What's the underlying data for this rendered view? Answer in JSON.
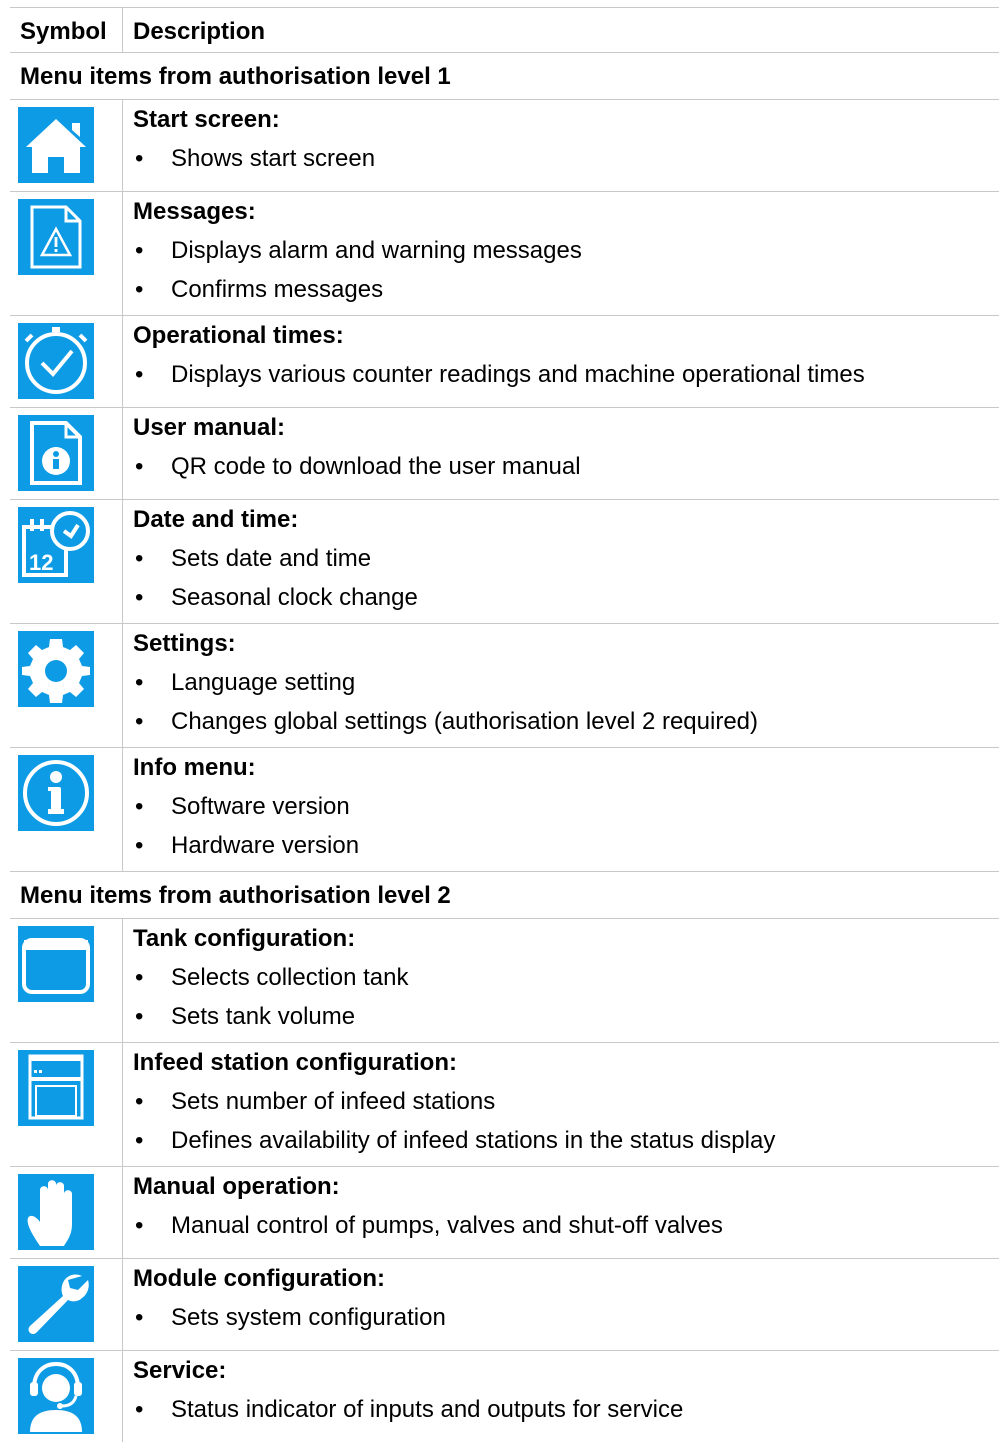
{
  "header": {
    "symbol": "Symbol",
    "description": "Description"
  },
  "sections": [
    {
      "heading": "Menu items from authorisation level 1",
      "items": [
        {
          "icon": "home-icon",
          "title": "Start screen:",
          "bullets": [
            "Shows start screen"
          ]
        },
        {
          "icon": "messages-warning-document-icon",
          "title": "Messages:",
          "bullets": [
            "Displays alarm and warning messages",
            "Confirms messages"
          ]
        },
        {
          "icon": "clock-icon",
          "title": "Operational times:",
          "bullets": [
            "Displays various counter readings and machine operational times"
          ]
        },
        {
          "icon": "info-document-icon",
          "title": "User manual:",
          "bullets": [
            "QR code to download the user manual"
          ]
        },
        {
          "icon": "calendar-clock-icon",
          "title": "Date and time:",
          "bullets": [
            "Sets date and time",
            "Seasonal clock change"
          ]
        },
        {
          "icon": "gear-icon",
          "title": "Settings:",
          "bullets": [
            "Language setting",
            "Changes global settings (authorisation level 2 required)"
          ]
        },
        {
          "icon": "info-circle-icon",
          "title": "Info menu:",
          "bullets": [
            "Software version",
            "Hardware version"
          ]
        }
      ]
    },
    {
      "heading": "Menu items from authorisation level 2",
      "items": [
        {
          "icon": "tank-icon",
          "title": "Tank configuration:",
          "bullets": [
            "Selects collection tank",
            "Sets tank volume"
          ]
        },
        {
          "icon": "infeed-station-icon",
          "title": "Infeed station configuration:",
          "bullets": [
            "Sets number of infeed stations",
            "Defines availability of infeed stations in the status display"
          ]
        },
        {
          "icon": "hand-icon",
          "title": "Manual operation:",
          "bullets": [
            "Manual control of pumps, valves and shut-off valves"
          ]
        },
        {
          "icon": "wrench-icon",
          "title": "Module configuration:",
          "bullets": [
            "Sets system configuration"
          ]
        },
        {
          "icon": "headset-service-icon",
          "title": "Service:",
          "bullets": [
            "Status indicator of inputs and outputs for service"
          ]
        }
      ]
    }
  ],
  "colors": {
    "icon_bg": "#0e9be6",
    "grid": "#c8c8c8"
  }
}
